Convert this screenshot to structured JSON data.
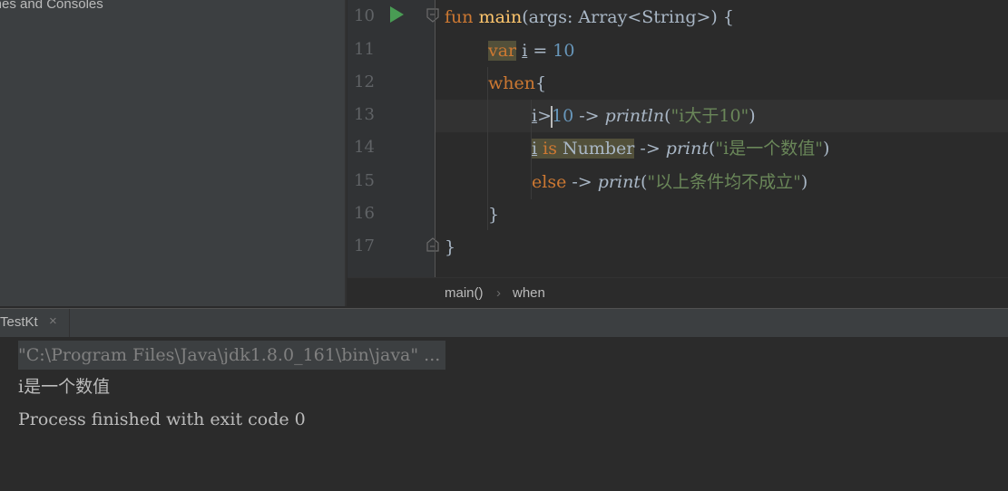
{
  "left_panel": {
    "title": "tches and Consoles"
  },
  "editor": {
    "line_numbers": [
      "10",
      "11",
      "12",
      "13",
      "14",
      "15",
      "16",
      "17"
    ],
    "lines": {
      "l10": {
        "kw": "fun",
        "fn": "main",
        "rest": "(args: Array<String>) {"
      },
      "l11": {
        "kw": "var",
        "var": "i",
        "op": " = ",
        "num": "10"
      },
      "l12": {
        "kw": "when",
        "rest": "{"
      },
      "l13": {
        "var": "i",
        "op": ">",
        "num": "10",
        "arrow": " -> ",
        "call": "println",
        "open": "(",
        "str": "\"i大于10\"",
        "close": ")"
      },
      "l14": {
        "var": "i",
        "kw": " is",
        "type": " Number",
        "arrow": " -> ",
        "call": "print",
        "open": "(",
        "str": "\"i是一个数值\"",
        "close": ")"
      },
      "l15": {
        "kw": "else",
        "arrow": " -> ",
        "call": "print",
        "open": "(",
        "str": "\"以上条件均不成立\"",
        "close": ")"
      },
      "l16": {
        "rest": "}"
      },
      "l17": {
        "rest": "}"
      }
    }
  },
  "breadcrumb": {
    "items": [
      "main()",
      "when"
    ],
    "separator": "›"
  },
  "run_tab": {
    "label": "TestKt",
    "close": "×"
  },
  "console": {
    "command": "\"C:\\Program Files\\Java\\jdk1.8.0_161\\bin\\java\" ...",
    "output": [
      "i是一个数值",
      "Process finished with exit code 0"
    ]
  },
  "colors": {
    "keyword": "#cc7832",
    "function": "#ffc66d",
    "number": "#6897bb",
    "string": "#6a8759",
    "run_icon": "#499c54"
  }
}
